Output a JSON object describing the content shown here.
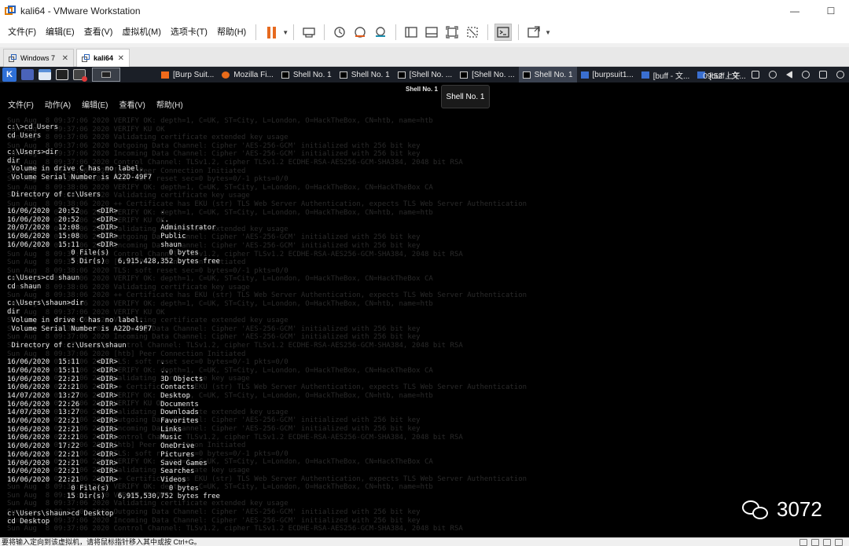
{
  "window": {
    "title": "kali64 - VMware Workstation",
    "minimize": "—",
    "maximize": "☐"
  },
  "menubar": {
    "items": [
      "文件(F)",
      "编辑(E)",
      "查看(V)",
      "虚拟机(M)",
      "选项卡(T)",
      "帮助(H)"
    ]
  },
  "vm_tabs": [
    {
      "label": "Windows 7",
      "close": "✕"
    },
    {
      "label": "kali64",
      "close": "✕"
    }
  ],
  "panel": {
    "kali_label": "K",
    "tasks": [
      {
        "label": "[Burp Suit...",
        "icon": "burp"
      },
      {
        "label": "Mozilla Fi...",
        "icon": "ff"
      },
      {
        "label": "Shell No. 1",
        "icon": "term"
      },
      {
        "label": "Shell No. 1",
        "icon": "term"
      },
      {
        "label": "[Shell No. ...",
        "icon": "term"
      },
      {
        "label": "[Shell No. ...",
        "icon": "term"
      },
      {
        "label": "Shell No. 1",
        "icon": "term"
      },
      {
        "label": "[burpsuit1...",
        "icon": "folder"
      },
      {
        "label": "[buff - 文...",
        "icon": "folder"
      },
      {
        "label": "[buff - 文...",
        "icon": "folder"
      }
    ],
    "clock": "09:52 上午"
  },
  "terminal": {
    "title": "Shell No. 1",
    "tooltip": "Shell No. 1",
    "menu": [
      "文件(F)",
      "动作(A)",
      "编辑(E)",
      "查看(V)",
      "帮助(H)"
    ],
    "lines": [
      "c:\\>cd Users",
      "cd Users",
      "",
      "c:\\Users>dir",
      "dir",
      " Volume in drive C has no label.",
      " Volume Serial Number is A22D-49F7",
      "",
      " Directory of c:\\Users",
      "",
      "16/06/2020  20:52    <DIR>          .",
      "16/06/2020  20:52    <DIR>          ..",
      "20/07/2020  12:08    <DIR>          Administrator",
      "16/06/2020  15:08    <DIR>          Public",
      "16/06/2020  15:11    <DIR>          shaun",
      "               0 File(s)              0 bytes",
      "               5 Dir(s)   6,915,428,352 bytes free",
      "",
      "c:\\Users>cd shaun",
      "cd shaun",
      "",
      "c:\\Users\\shaun>dir",
      "dir",
      " Volume in drive C has no label.",
      " Volume Serial Number is A22D-49F7",
      "",
      " Directory of c:\\Users\\shaun",
      "",
      "16/06/2020  15:11    <DIR>          .",
      "16/06/2020  15:11    <DIR>          ..",
      "16/06/2020  22:21    <DIR>          3D Objects",
      "16/06/2020  22:21    <DIR>          Contacts",
      "14/07/2020  13:27    <DIR>          Desktop",
      "16/06/2020  22:26    <DIR>          Documents",
      "14/07/2020  13:27    <DIR>          Downloads",
      "16/06/2020  22:21    <DIR>          Favorites",
      "16/06/2020  22:21    <DIR>          Links",
      "16/06/2020  22:21    <DIR>          Music",
      "16/06/2020  17:22    <DIR>          OneDrive",
      "16/06/2020  22:21    <DIR>          Pictures",
      "16/06/2020  22:21    <DIR>          Saved Games",
      "16/06/2020  22:21    <DIR>          Searches",
      "16/06/2020  22:21    <DIR>          Videos",
      "               0 File(s)              0 bytes",
      "              15 Dir(s)   6,915,530,752 bytes free",
      "",
      "c:\\Users\\shaun>cd Desktop",
      "cd Desktop"
    ],
    "background_lines": [
      "Sun Aug  8 09:37:06 2020 VERIFY OK: depth=1, C=UK, ST=City, L=London, O=HackTheBox, CN=htb, name=htb",
      "Sun Aug  8 09:37:06 2020 VERIFY KU OK",
      "Sun Aug  8 09:37:06 2020 Validating certificate extended key usage",
      "Sun Aug  8 09:37:06 2020 Outgoing Data Channel: Cipher 'AES-256-GCM' initialized with 256 bit key",
      "Sun Aug  8 09:37:06 2020 Incoming Data Channel: Cipher 'AES-256-GCM' initialized with 256 bit key",
      "Sun Aug  8 09:37:06 2020 Control Channel: TLSv1.2, cipher TLSv1.2 ECDHE-RSA-AES256-GCM-SHA384, 2048 bit RSA",
      "Sun Aug  8 09:37:06 2020 [htb] Peer Connection Initiated",
      "Sun Aug  8 09:38:06 2020 TLS: soft reset sec=0 bytes=0/-1 pkts=0/0",
      "Sun Aug  8 09:38:06 2020 VERIFY OK: depth=1, C=UK, ST=City, L=London, O=HackTheBox, CN=HackTheBox CA",
      "Sun Aug  8 09:38:06 2020 Validating certificate key usage",
      "Sun Aug  8 09:38:06 2020 ++ Certificate has EKU (str) TLS Web Server Authentication, expects TLS Web Server Authentication"
    ]
  },
  "watermark": {
    "text": "3072"
  },
  "statusbar": {
    "text": "要将输入定向到该虚拟机，请将鼠标指针移入其中或按 Ctrl+G。"
  }
}
